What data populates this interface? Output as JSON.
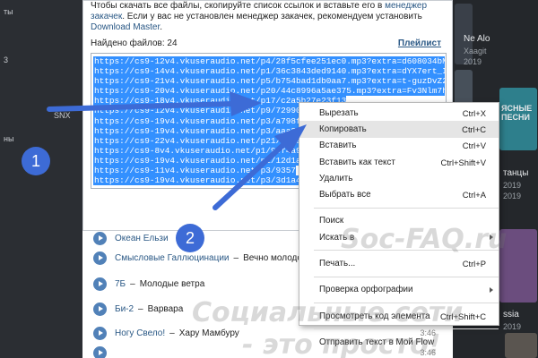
{
  "background": {
    "left_fragments": [
      "ты",
      "3",
      "SNX",
      "ны"
    ],
    "right_panel": {
      "artist_name": "Ne Alo",
      "artist_sub": "Xaagit",
      "year_a": "2019",
      "year_b": "2019",
      "item_a": "танцы",
      "item_b": "2019",
      "item_c": "ЯСНЫЕ ПЕСНИ",
      "item_d": "ssia",
      "item_e": "2019"
    }
  },
  "dialog": {
    "hint_prefix": "Чтобы скачать все файлы, скопируйте список ссылок и вставьте его в ",
    "hint_link_manager": "менеджер закачек",
    "hint_mid": ". Если у вас не установлен менеджер закачек, рекомендуем установить ",
    "hint_link_dm": "Download Master",
    "hint_suffix": ".",
    "found_label": "Найдено файлов: 24",
    "playlist_link": "Плейлист",
    "links": [
      "https://cs9-12v4.vkuseraudio.net/p4/28f5cfee251ec0.mp3?extra=d608034bMm8TAxDex1Wh",
      "https://cs9-14v4.vkuseraudio.net/p1/36c3843ded9140.mp3?extra=dYX7ert_IPFifxcgvzMe4hG",
      "https://cs9-21v4.vkuseraudio.net/p5/b754bad1db0aa7.mp3?extra=t-guzDvZ2J2N3ewkgK9G_Wv",
      "https://cs9-20v4.vkuseraudio.net/p20/44c8996a5ae375.mp3?extra=Fv3Nlm7hpLEKuluuR6vf",
      "https://cs9-18v4.vkuseraudio.net/p17/c2a5b27e23f13",
      "https://cs9-12v4.vkuseraudio.net/p9/72990b2287b67f",
      "https://cs9-19v4.vkuseraudio.net/p3/a798fb7fbf6a37",
      "https://cs9-19v4.vkuseraudio.net/p3/aaa313298dd3ec",
      "https://cs9-22v4.vkuseraudio.net/p21/8889ff47d820",
      "https://cs9-8v4.vkuseraudio.net/p1/99f4a95a119",
      "https://cs9-19v4.vkuseraudio.net/p1/12d1a4",
      "https://cs9-11v4.vkuseraudio.net/p3/9357",
      "https://cs9-19v4.vkuseraudio.net/p3/3d1a4ea962f3d6."
    ]
  },
  "tracks": [
    {
      "artist": "Океан Ельзи",
      "title": "",
      "duration": ""
    },
    {
      "artist": "Смысловые Галлюцинации",
      "title": "Вечно молодой",
      "duration": ""
    },
    {
      "artist": "7Б",
      "title": "Молодые ветра",
      "duration": ""
    },
    {
      "artist": "Би-2",
      "title": "Варвара",
      "duration": ""
    },
    {
      "artist": "Ногу Свело!",
      "title": "Хару Мамбуру",
      "duration": "3:46"
    },
    {
      "artist": "",
      "title": "",
      "duration": "3:46"
    }
  ],
  "context_menu": {
    "cut": {
      "label": "Вырезать",
      "shortcut": "Ctrl+X"
    },
    "copy": {
      "label": "Копировать",
      "shortcut": "Ctrl+C"
    },
    "paste": {
      "label": "Вставить",
      "shortcut": "Ctrl+V"
    },
    "paste_plain": {
      "label": "Вставить как текст",
      "shortcut": "Ctrl+Shift+V"
    },
    "delete": {
      "label": "Удалить",
      "shortcut": ""
    },
    "select_all": {
      "label": "Выбрать все",
      "shortcut": "Ctrl+A"
    },
    "search": {
      "label": "Поиск",
      "shortcut": ""
    },
    "search_in": {
      "label": "Искать в",
      "shortcut": ""
    },
    "print": {
      "label": "Печать...",
      "shortcut": "Ctrl+P"
    },
    "spellcheck": {
      "label": "Проверка орфографии",
      "shortcut": ""
    },
    "inspect": {
      "label": "Просмотреть код элемента",
      "shortcut": "Ctrl+Shift+C"
    },
    "send_flow": {
      "label": "Отправить текст в Мой Flow",
      "shortcut": ""
    }
  },
  "annotations": {
    "badge_1": "1",
    "badge_2": "2",
    "watermark_a": "Soc-FAQ.ru",
    "watermark_b": "Социальные сети",
    "watermark_c": "- это просто!",
    "arrow_color": "#3d6bd6"
  }
}
